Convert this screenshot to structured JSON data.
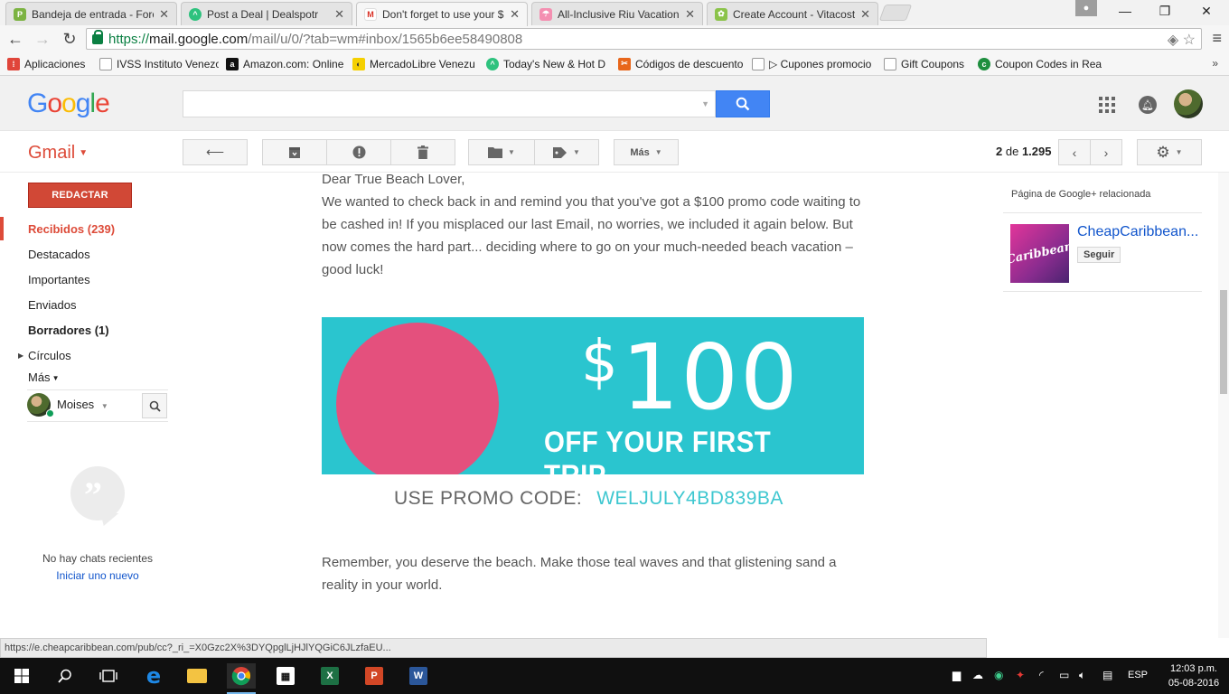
{
  "browser": {
    "tabs": [
      {
        "title": "Bandeja de entrada - Foro",
        "icon": "ptc-favicon",
        "active": false
      },
      {
        "title": "Post a Deal | Dealspotr",
        "icon": "dealspotr-favicon",
        "active": false
      },
      {
        "title": "Don't forget to use your $",
        "icon": "gmail-favicon",
        "active": true
      },
      {
        "title": "All-Inclusive Riu Vacation",
        "icon": "umbrella-favicon",
        "active": false
      },
      {
        "title": "Create Account - Vitacost",
        "icon": "vitacost-favicon",
        "active": false
      }
    ],
    "url_scheme": "https://",
    "url_host": "mail.google.com",
    "url_path": "/mail/u/0/?tab=wm#inbox/1565b6ee58490808",
    "bookmarks": [
      {
        "label": "Aplicaciones",
        "icon": "apps-grid-icon",
        "color": "#e0453a"
      },
      {
        "label": "IVSS Instituto Venezol",
        "icon": "page-icon",
        "color": "#888888"
      },
      {
        "label": "Amazon.com: Online",
        "icon": "amazon-icon",
        "color": "#111111"
      },
      {
        "label": "MercadoLibre Venezu",
        "icon": "mercadolibre-icon",
        "color": "#f5d000"
      },
      {
        "label": "Today's New & Hot D",
        "icon": "dealspotr-icon",
        "color": "#2ec27e"
      },
      {
        "label": "Códigos de descuento",
        "icon": "coupon-icon",
        "color": "#e8661b"
      },
      {
        "label": "▷ Cupones promocio",
        "icon": "page-icon",
        "color": "#888888"
      },
      {
        "label": "Gift Coupons",
        "icon": "page-icon",
        "color": "#888888"
      },
      {
        "label": "Coupon Codes in Rea",
        "icon": "coupon-green-icon",
        "color": "#1e8e3e"
      }
    ]
  },
  "gmail": {
    "brand": "Gmail",
    "search_placeholder": "",
    "toolbar_more": "Más",
    "pager_pos": "2",
    "pager_of": "de",
    "pager_total": "1.295",
    "compose": "REDACTAR",
    "nav": [
      {
        "label": "Recibidos (239)"
      },
      {
        "label": "Destacados"
      },
      {
        "label": "Importantes"
      },
      {
        "label": "Enviados"
      },
      {
        "label": "Borradores (1)"
      },
      {
        "label": "Círculos"
      },
      {
        "label": "Más"
      }
    ],
    "chat_user": "Moises",
    "no_chats": "No hay chats recientes",
    "start_chat": "Iniciar uno nuevo"
  },
  "email": {
    "greeting": "Dear True Beach Lover,",
    "body1": "We wanted to check back in and remind you that you've got a $100 promo code waiting to be cashed in! If you misplaced our last Email, no worries, we included it again below. But now comes the hard part... deciding where to go on your much-needed beach vacation – good luck!",
    "banner_dollar": "$",
    "banner_amount": "100",
    "banner_sub": "OFF YOUR FIRST TRIP",
    "promo_label": "USE PROMO CODE:",
    "promo_code": "WELJULY4BD839BA",
    "body2": "Remember, you deserve the beach. Make those teal waves and that glistening sand a reality in your world."
  },
  "right_panel": {
    "title": "Página de Google+ relacionada",
    "page_name": "CheapCaribbean...",
    "thumb_text": "Caribbean",
    "follow": "Seguir"
  },
  "status_url": "https://e.cheapcaribbean.com/pub/cc?_ri_=X0Gzc2X%3DYQpglLjHJlYQGiC6JLzfaEU...",
  "taskbar": {
    "lang": "ESP",
    "time": "12:03 p.m.",
    "date": "05-08-2016"
  },
  "colors": {
    "gmail_red": "#dd4b39",
    "compose_red": "#d14836",
    "search_blue": "#4285f4",
    "promo_teal": "#2ac5cf",
    "promo_pink": "#e4507d",
    "link_blue": "#1155cc"
  }
}
